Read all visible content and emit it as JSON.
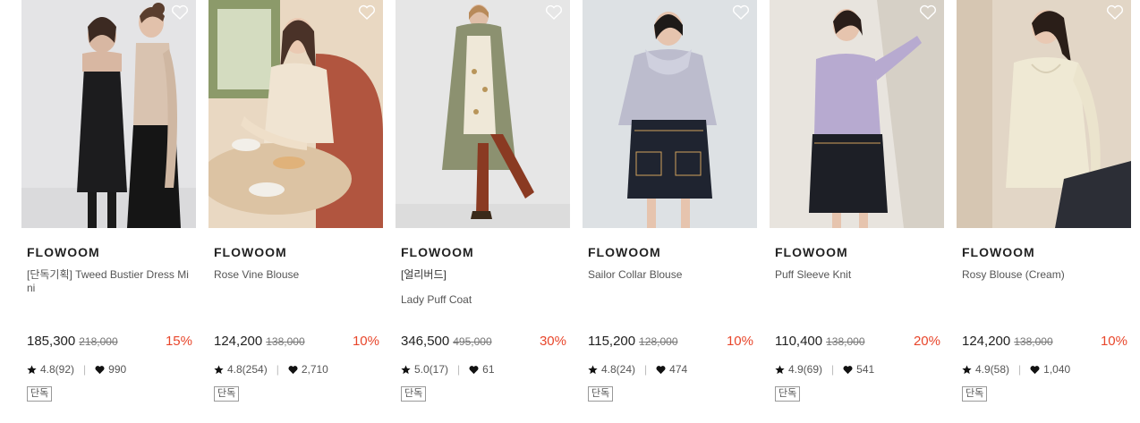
{
  "products": [
    {
      "brand": "FLOWOOM",
      "name": "[단독기획] Tweed Bustier Dress Mini",
      "name_sub": "",
      "price": "185,300",
      "original_price": "218,000",
      "discount": "15%",
      "rating": "4.8(92)",
      "likes": "990",
      "badge": "단독",
      "image_desc": "two-models-tweed-dress"
    },
    {
      "brand": "FLOWOOM",
      "name": "Rose Vine Blouse",
      "name_sub": "",
      "price": "124,200",
      "original_price": "138,000",
      "discount": "10%",
      "rating": "4.8(254)",
      "likes": "2,710",
      "badge": "단독",
      "image_desc": "model-cafe-blouse"
    },
    {
      "brand": "FLOWOOM",
      "name": "Lady Puff Coat",
      "name_sub": "[얼리버드]",
      "price": "346,500",
      "original_price": "495,000",
      "discount": "30%",
      "rating": "5.0(17)",
      "likes": "61",
      "badge": "단독",
      "image_desc": "model-khaki-coat"
    },
    {
      "brand": "FLOWOOM",
      "name": "Sailor Collar Blouse",
      "name_sub": "",
      "price": "115,200",
      "original_price": "128,000",
      "discount": "10%",
      "rating": "4.8(24)",
      "likes": "474",
      "badge": "단독",
      "image_desc": "model-lavender-blouse"
    },
    {
      "brand": "FLOWOOM",
      "name": "Puff Sleeve Knit",
      "name_sub": "",
      "price": "110,400",
      "original_price": "138,000",
      "discount": "20%",
      "rating": "4.9(69)",
      "likes": "541",
      "badge": "단독",
      "image_desc": "model-lilac-knit"
    },
    {
      "brand": "FLOWOOM",
      "name": "Rosy Blouse (Cream)",
      "name_sub": "",
      "price": "124,200",
      "original_price": "138,000",
      "discount": "10%",
      "rating": "4.9(58)",
      "likes": "1,040",
      "badge": "단독",
      "image_desc": "model-cream-blouse"
    }
  ],
  "colors": {
    "discount": "#e8462b",
    "text": "#222222",
    "muted": "#777777"
  }
}
